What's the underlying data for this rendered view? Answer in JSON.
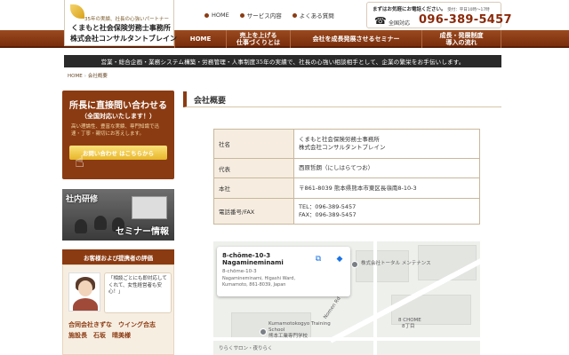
{
  "header": {
    "logo_tagline": "35年の実績、社長の心強いパートナー",
    "logo_name1": "くまもと社会保険労務士事務所",
    "logo_name2": "株式会社コンサルタントブレイン",
    "topnav": [
      "HOME",
      "サービス内容",
      "よくある質問"
    ],
    "phone_prompt": "まずはお気軽にお電話ください。",
    "phone_hours": "受付：平日10時〜17時",
    "phone_label": "全国対応",
    "phone_number": "096-389-5457"
  },
  "mainnav": [
    {
      "line1": "HOME",
      "line2": ""
    },
    {
      "line1": "売上を上げる",
      "line2": "仕事づくりとは"
    },
    {
      "line1": "会社を成長発展させるセミナー",
      "line2": ""
    },
    {
      "line1": "成長・発展制度",
      "line2": "導入の流れ"
    }
  ],
  "banner": "営業・総合企画・業務システム構築・労務管理・人事制度35年の実績で、社長の心強い相談相手として、企業の繁栄をお手伝いします。",
  "breadcrumb": {
    "home": "HOME",
    "current": "会社概要"
  },
  "sidebar": {
    "contact_title": "所長に直接問い合わせる",
    "contact_sub": "（全国対応いたします！）",
    "contact_desc": "高い理論性、豊富な実績、専門知識で迅速・丁寧・親切にお答えします。",
    "contact_button": "お問い合わせ はこちらから",
    "seminar_line1": "社内研修",
    "seminar_line2": "セミナー情報",
    "voice_heading": "お客様および提携者の評価",
    "voice_quote": "「相談ごとにも即対応してくれて、女性経営者も安心！」",
    "voice_org1": "合同会社きずな　ウイング合志",
    "voice_org2": "施設長　石坂　晴美様"
  },
  "section_title": "会社概要",
  "company_table": [
    {
      "key": "社名",
      "value": [
        "くまもと社会保険労務士事務所",
        "株式会社コンサルタントブレイン"
      ]
    },
    {
      "key": "代表",
      "value": [
        "西原哲朗（にしはらてつお）"
      ]
    },
    {
      "key": "本社",
      "value": [
        "〒861-8039 熊本県熊本市東区長嶺南8-10-3"
      ]
    },
    {
      "key": "電話番号/FAX",
      "value": [
        "TEL：096-389-5457",
        "FAX：096-389-5457"
      ]
    }
  ],
  "map": {
    "card_line1": "8-chōme-10-3",
    "card_line2": "Nagamineminami",
    "card_line3": "8-chōme-10-3",
    "card_line4": "Nagamineminami, Higashi Ward, Kumamoto, 861-8039, Japan",
    "poi1": "株式会社トータル メンテナンス",
    "poi2": "Kumamotokogyo Training School",
    "poi2_jp": "熊本工業専門学校",
    "road": "Nomen Rd",
    "district_en": "8 CHOME",
    "district_jp": "8丁目",
    "poi3": "りらくサロン・夜りらく"
  }
}
